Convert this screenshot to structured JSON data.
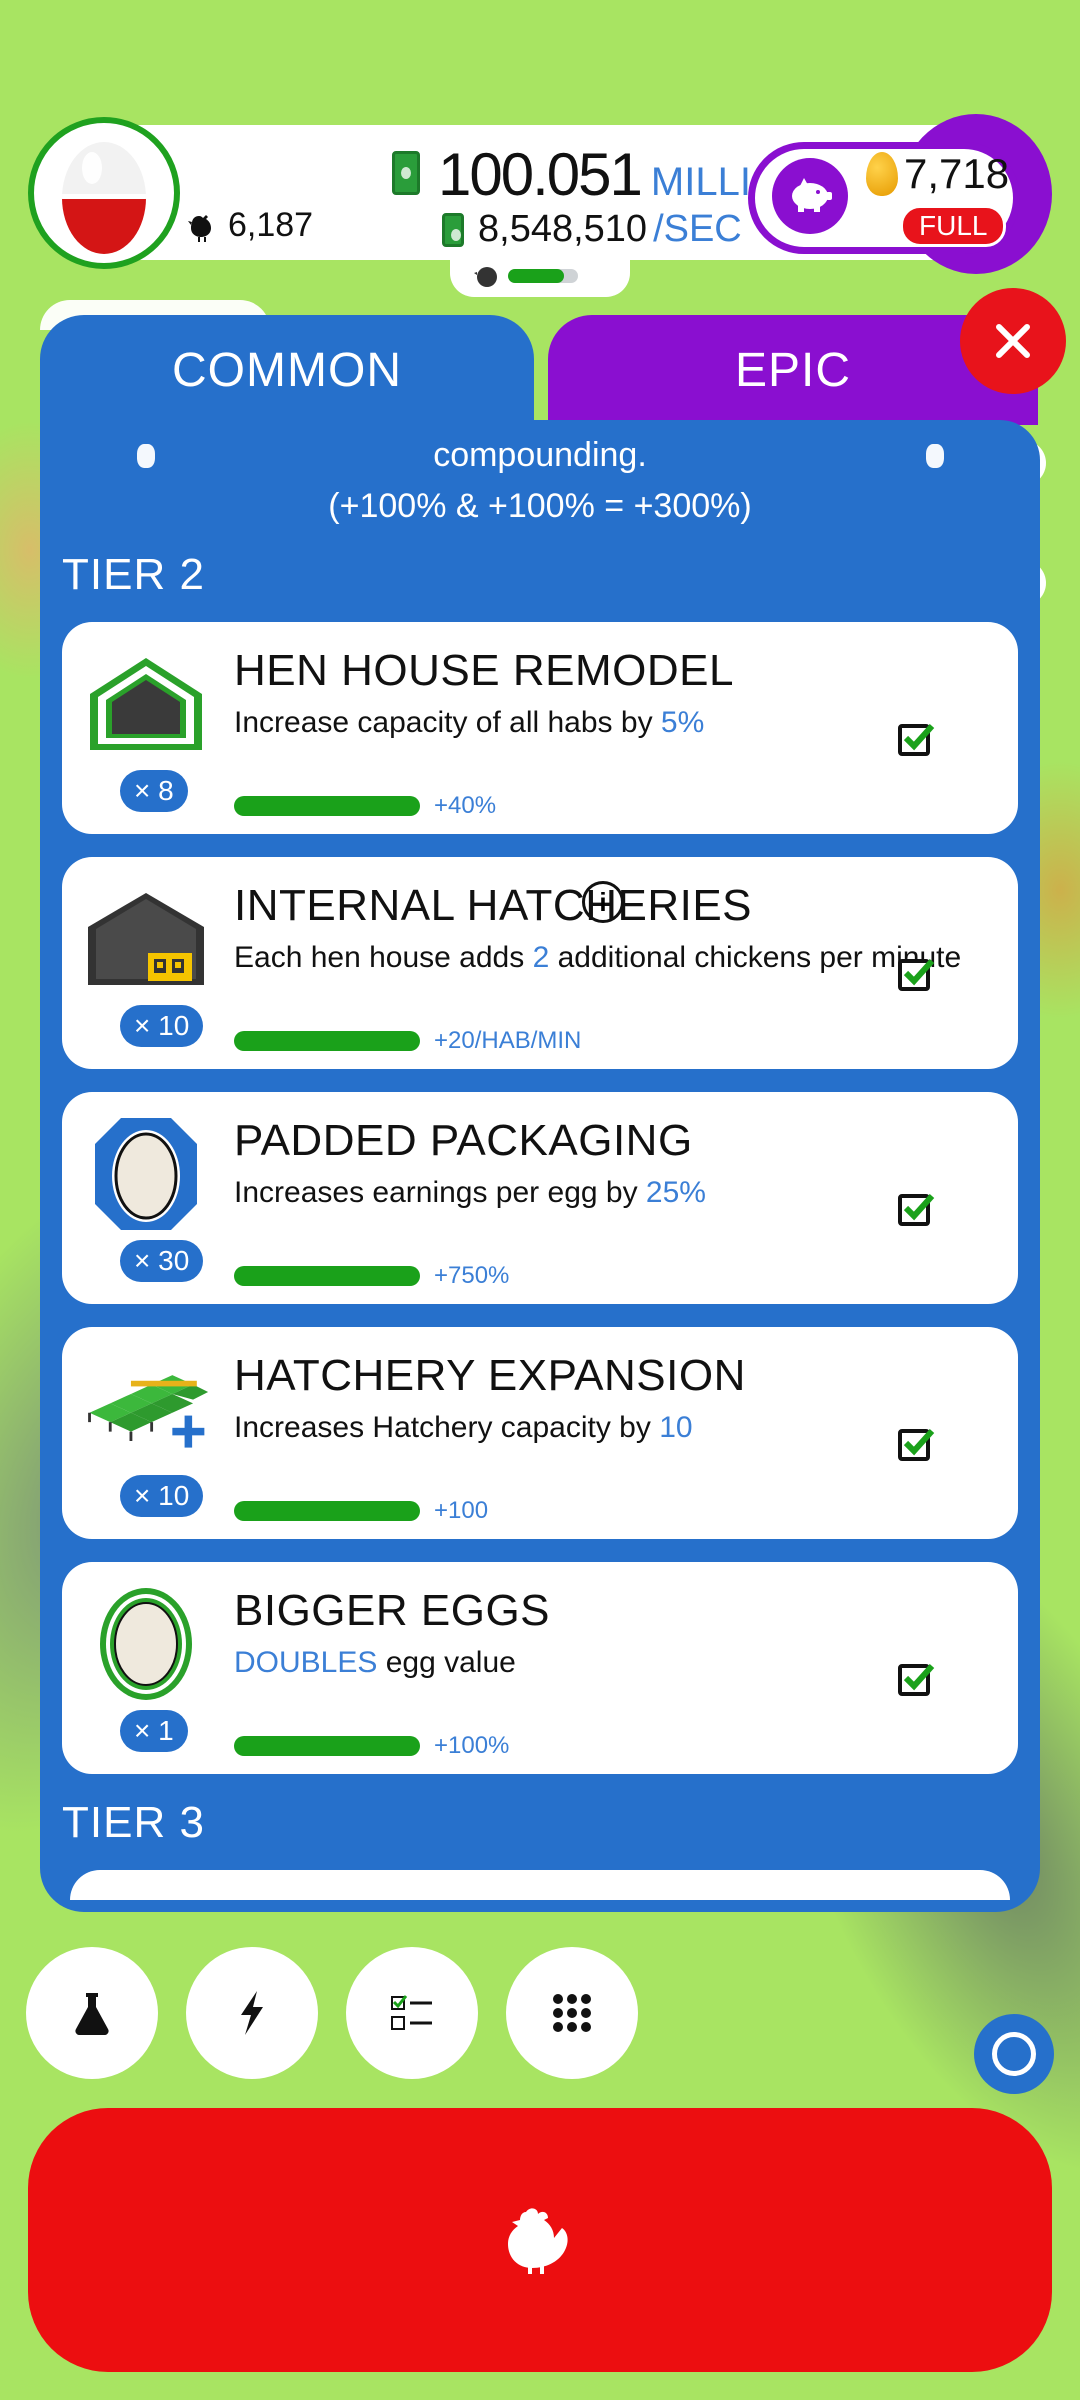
{
  "status": {
    "chickens": "6,187",
    "money_value": "100.051",
    "money_unit": "MILLION",
    "rate_value": "8,548,510",
    "rate_unit": "/SEC",
    "golden_eggs": "7,718",
    "piggy_status": "FULL"
  },
  "tabs": [
    {
      "label": "COMMON",
      "active": true
    },
    {
      "label": "EPIC",
      "active": false
    }
  ],
  "tip": {
    "line1": "compounding.",
    "line2": "(+100% & +100% = +300%)"
  },
  "tiers": {
    "tier2_label": "TIER 2",
    "tier3_label": "TIER 3"
  },
  "research": [
    {
      "title": "HEN HOUSE REMODEL",
      "desc_pre": "Increase capacity of all habs by ",
      "desc_hl": "5%",
      "desc_post": "",
      "mult": "× 8",
      "bonus": "+40%",
      "progress": 1.0,
      "purchased": true,
      "icon": "hen-house-icon"
    },
    {
      "title": "INTERNAL HATCHERIES",
      "desc_pre": "Each hen house adds ",
      "desc_hl": "2",
      "desc_post": " additional chickens per minute",
      "mult": "× 10",
      "bonus": "+20/HAB/MIN",
      "progress": 1.0,
      "purchased": true,
      "icon": "hatchery-house-icon"
    },
    {
      "title": "PADDED PACKAGING",
      "desc_pre": "Increases earnings per egg by ",
      "desc_hl": "25%",
      "desc_post": "",
      "mult": "× 30",
      "bonus": "+750%",
      "progress": 1.0,
      "purchased": true,
      "icon": "padded-egg-icon"
    },
    {
      "title": "HATCHERY EXPANSION",
      "desc_pre": "Increases Hatchery capacity by ",
      "desc_hl": "10",
      "desc_post": "",
      "mult": "× 10",
      "bonus": "+100",
      "progress": 1.0,
      "purchased": true,
      "icon": "hatchery-expansion-icon"
    },
    {
      "title": "BIGGER EGGS",
      "desc_pre": "",
      "desc_hl": "DOUBLES",
      "desc_post": " egg value",
      "mult": "× 1",
      "bonus": "+100%",
      "progress": 1.0,
      "purchased": true,
      "icon": "bigger-egg-icon"
    }
  ],
  "colors": {
    "background": "#a8e462",
    "panel_blue": "#2670cb",
    "epic_purple": "#8a0fd0",
    "progress_green": "#1aa11a",
    "hatch_red": "#ec0e10"
  },
  "nav": [
    "research-icon",
    "boost-icon",
    "missions-icon",
    "menu-grid-icon"
  ]
}
